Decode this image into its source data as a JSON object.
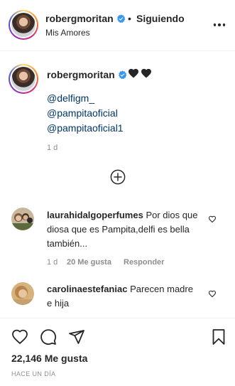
{
  "header": {
    "username": "robergmoritan",
    "separator": "•",
    "follow_status": "Siguiendo",
    "subtitle": "Mis Amores",
    "more_icon": "more-options-icon"
  },
  "caption": {
    "username": "robergmoritan",
    "heart_icons": [
      "black-heart-icon",
      "black-heart-icon"
    ],
    "mentions": [
      "@delfigm_",
      "@pampitaoficial",
      "@pampitaoficial1"
    ],
    "time": "1 d"
  },
  "load_more_icon": "plus-circle-icon",
  "comments": [
    {
      "username": "laurahidalgoperfumes",
      "text": "Por dios que diosa que es Pampita,delfi es bella también...",
      "time": "1 d",
      "likes": "20 Me gusta",
      "reply": "Responder"
    },
    {
      "username": "carolinaestefaniac",
      "text": "Parecen madre e hija"
    }
  ],
  "actions": {
    "like_icon": "heart-outline-icon",
    "comment_icon": "comment-icon",
    "share_icon": "share-icon",
    "save_icon": "bookmark-icon"
  },
  "likes_count": "22,146 Me gusta",
  "post_date": "Hace un día",
  "colors": {
    "text": "#262626",
    "muted": "#8e8e8e",
    "link": "#00376b",
    "verified": "#3897f0"
  }
}
